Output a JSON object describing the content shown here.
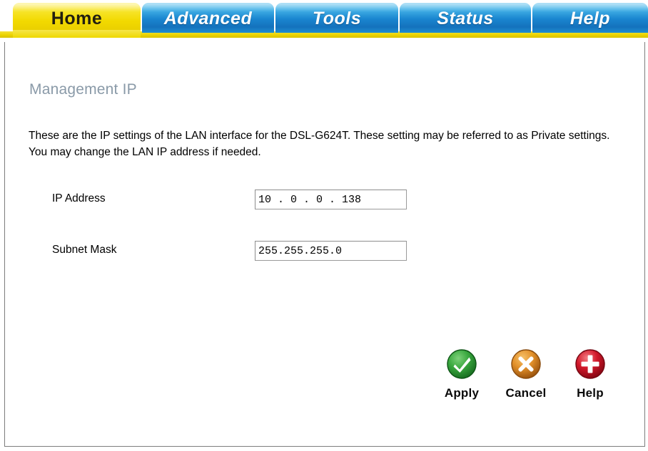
{
  "window": {
    "title": "Management IP"
  },
  "nav": {
    "tabs": [
      {
        "label": "Home",
        "state": "active",
        "style": "yellow"
      },
      {
        "label": "Advanced",
        "state": "inactive",
        "style": "blue"
      },
      {
        "label": "Tools",
        "state": "inactive",
        "style": "blue"
      },
      {
        "label": "Status",
        "state": "inactive",
        "style": "blue"
      },
      {
        "label": "Help",
        "state": "inactive",
        "style": "blue"
      }
    ],
    "active_tab": "Home"
  },
  "main": {
    "heading": "Management IP",
    "description": "These are the IP settings of the LAN interface for the DSL-G624T. These setting may be referred to as Private settings. You may change the LAN IP address if needed.",
    "fields": [
      {
        "label": "IP Address",
        "value": "10 . 0 . 0 . 138",
        "placeholder": ""
      },
      {
        "label": "Subnet Mask",
        "value": "255.255.255.0",
        "placeholder": ""
      }
    ]
  },
  "actions": [
    {
      "label": "Apply",
      "icon": "check-circle-icon",
      "color": "#2e9b38"
    },
    {
      "label": "Cancel",
      "icon": "x-circle-icon",
      "color": "#e08a1a"
    },
    {
      "label": "Help",
      "icon": "plus-circle-icon",
      "color": "#cc1122"
    }
  ],
  "colors": {
    "tab_active": "#f2d900",
    "tab_inactive": "#1a86d0",
    "heading": "#8a9aa8",
    "text": "#000000",
    "border": "#7d7d7d",
    "apply_green": "#2e9b38",
    "cancel_orange": "#e08a1a",
    "help_red": "#cc1122"
  }
}
